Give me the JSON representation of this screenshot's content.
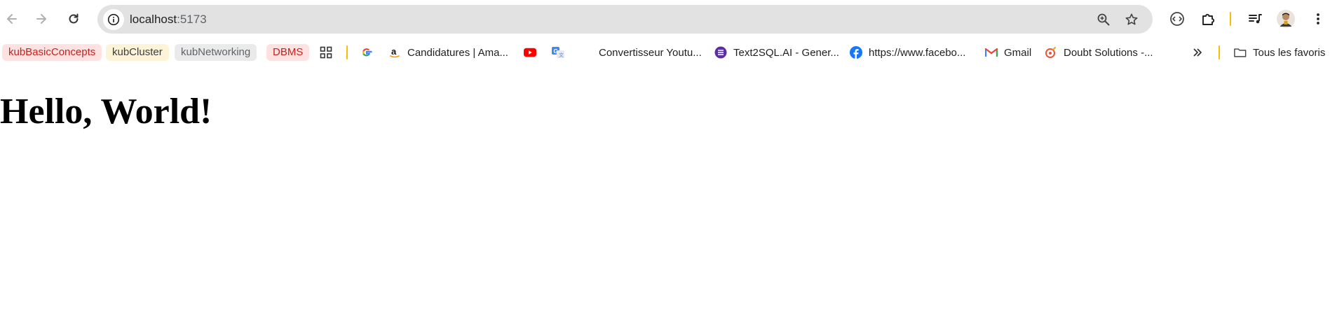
{
  "browser": {
    "address_host": "localhost",
    "address_port": ":5173",
    "folder_label": "Tous les favoris"
  },
  "bookmarks": {
    "groups": [
      {
        "label": "kubBasicConcepts",
        "bg": "#fde2e1",
        "fg": "#c5221f"
      },
      {
        "label": "kubCluster",
        "bg": "#fdf4d7",
        "fg": "#3c3c3c"
      },
      {
        "label": "kubNetworking",
        "bg": "#eaeaea",
        "fg": "#5f6368"
      },
      {
        "label": "DBMS",
        "bg": "#fde2e1",
        "fg": "#c5221f"
      }
    ],
    "items": [
      {
        "label": "Candidatures | Ama..."
      },
      {
        "label": "Convertisseur Youtu..."
      },
      {
        "label": "Text2SQL.AI - Gener..."
      },
      {
        "label": "https://www.facebo..."
      },
      {
        "label": "Gmail"
      },
      {
        "label": "Doubt Solutions -..."
      }
    ]
  },
  "page": {
    "heading": "Hello, World!"
  },
  "icons": [
    "back-arrow-icon",
    "forward-arrow-icon",
    "reload-icon",
    "info-icon",
    "zoom-icon",
    "star-icon",
    "media-router-icon",
    "extensions-icon",
    "reading-list-icon",
    "avatar",
    "more-menu-icon",
    "apps-grid-icon",
    "google-icon",
    "amazon-icon",
    "youtube-icon",
    "translate-icon",
    "text2sql-icon",
    "facebook-icon",
    "gmail-icon",
    "doubt-solutions-icon",
    "chevron-double-right-icon",
    "folder-icon"
  ]
}
